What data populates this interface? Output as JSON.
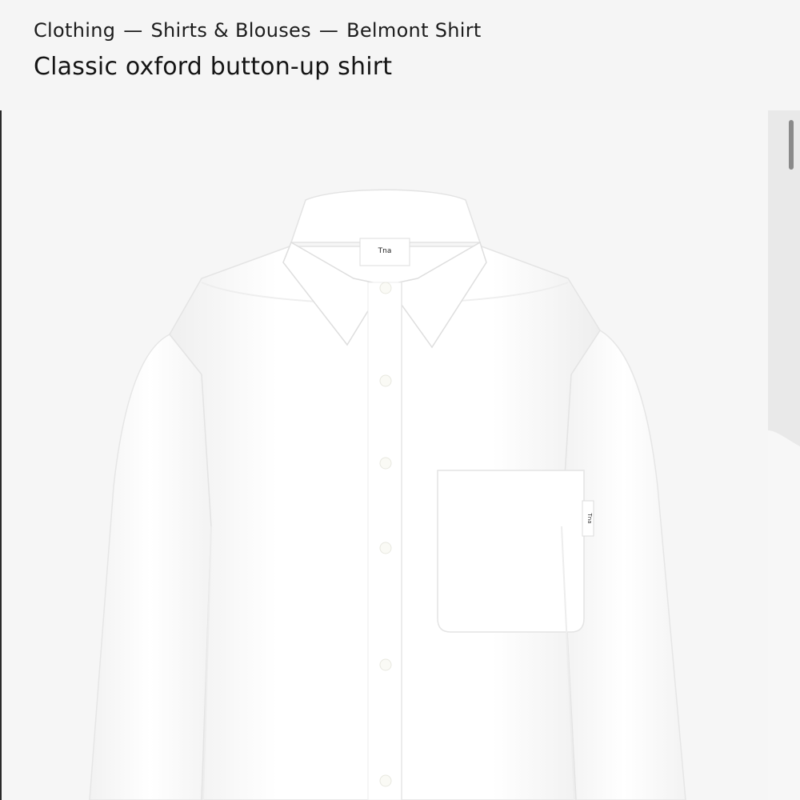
{
  "breadcrumb": {
    "items": [
      "Clothing",
      "Shirts & Blouses",
      "Belmont Shirt"
    ],
    "separator": "—"
  },
  "product": {
    "title": "Classic oxford button-up shirt",
    "label_brand": "Tna",
    "pocket_tag": "Tna"
  },
  "colors": {
    "background": "#f5f5f5",
    "shirt": "#ffffff",
    "text": "#1a1a1a"
  }
}
